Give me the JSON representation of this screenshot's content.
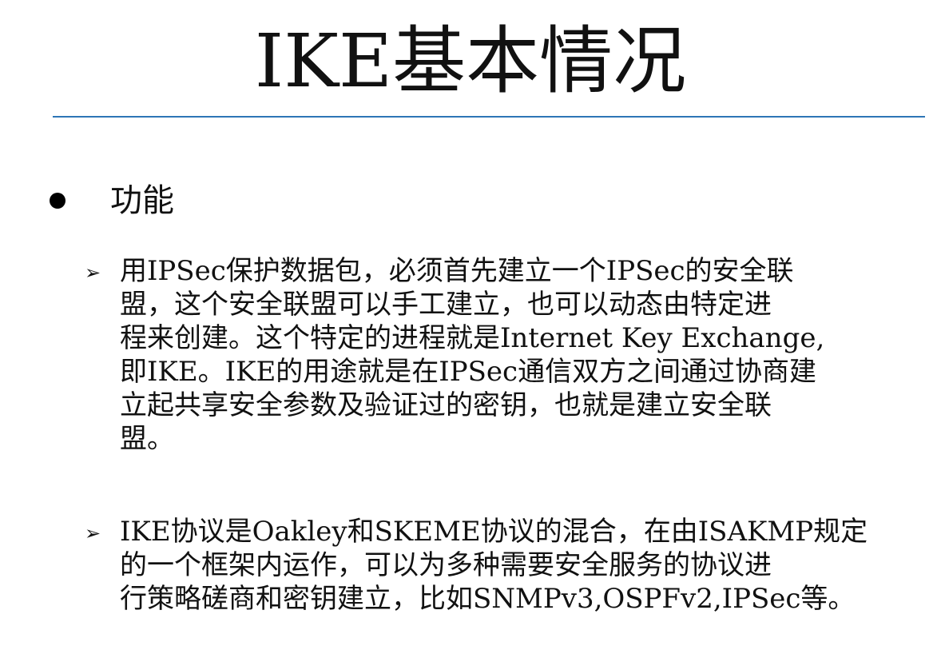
{
  "slide": {
    "title": "IKE基本情况"
  },
  "bullet": {
    "label": "功能"
  },
  "sub_items": [
    {
      "marker": "➢",
      "lines": [
        "用IPSec保护数据包，必须首先建立一个IPSec的安全联",
        "盟，这个安全联盟可以手工建立，也可以动态由特定进",
        "程来创建。这个特定的进程就是Internet Key Exchange,",
        "即IKE。IKE的用途就是在IPSec通信双方之间通过协商建",
        "立起共享安全参数及验证过的密钥，也就是建立安全联",
        "盟。"
      ]
    },
    {
      "marker": "➢",
      "lines": [
        "IKE协议是Oakley和SKEME协议的混合，在由ISAKMP规定",
        "的一个框架内运作，可以为多种需要安全服务的协议进",
        "行策略磋商和密钥建立，比如SNMPv3,OSPFv2,IPSec等。"
      ]
    }
  ],
  "colors": {
    "rule": "#2e75b6",
    "text": "#111111"
  }
}
